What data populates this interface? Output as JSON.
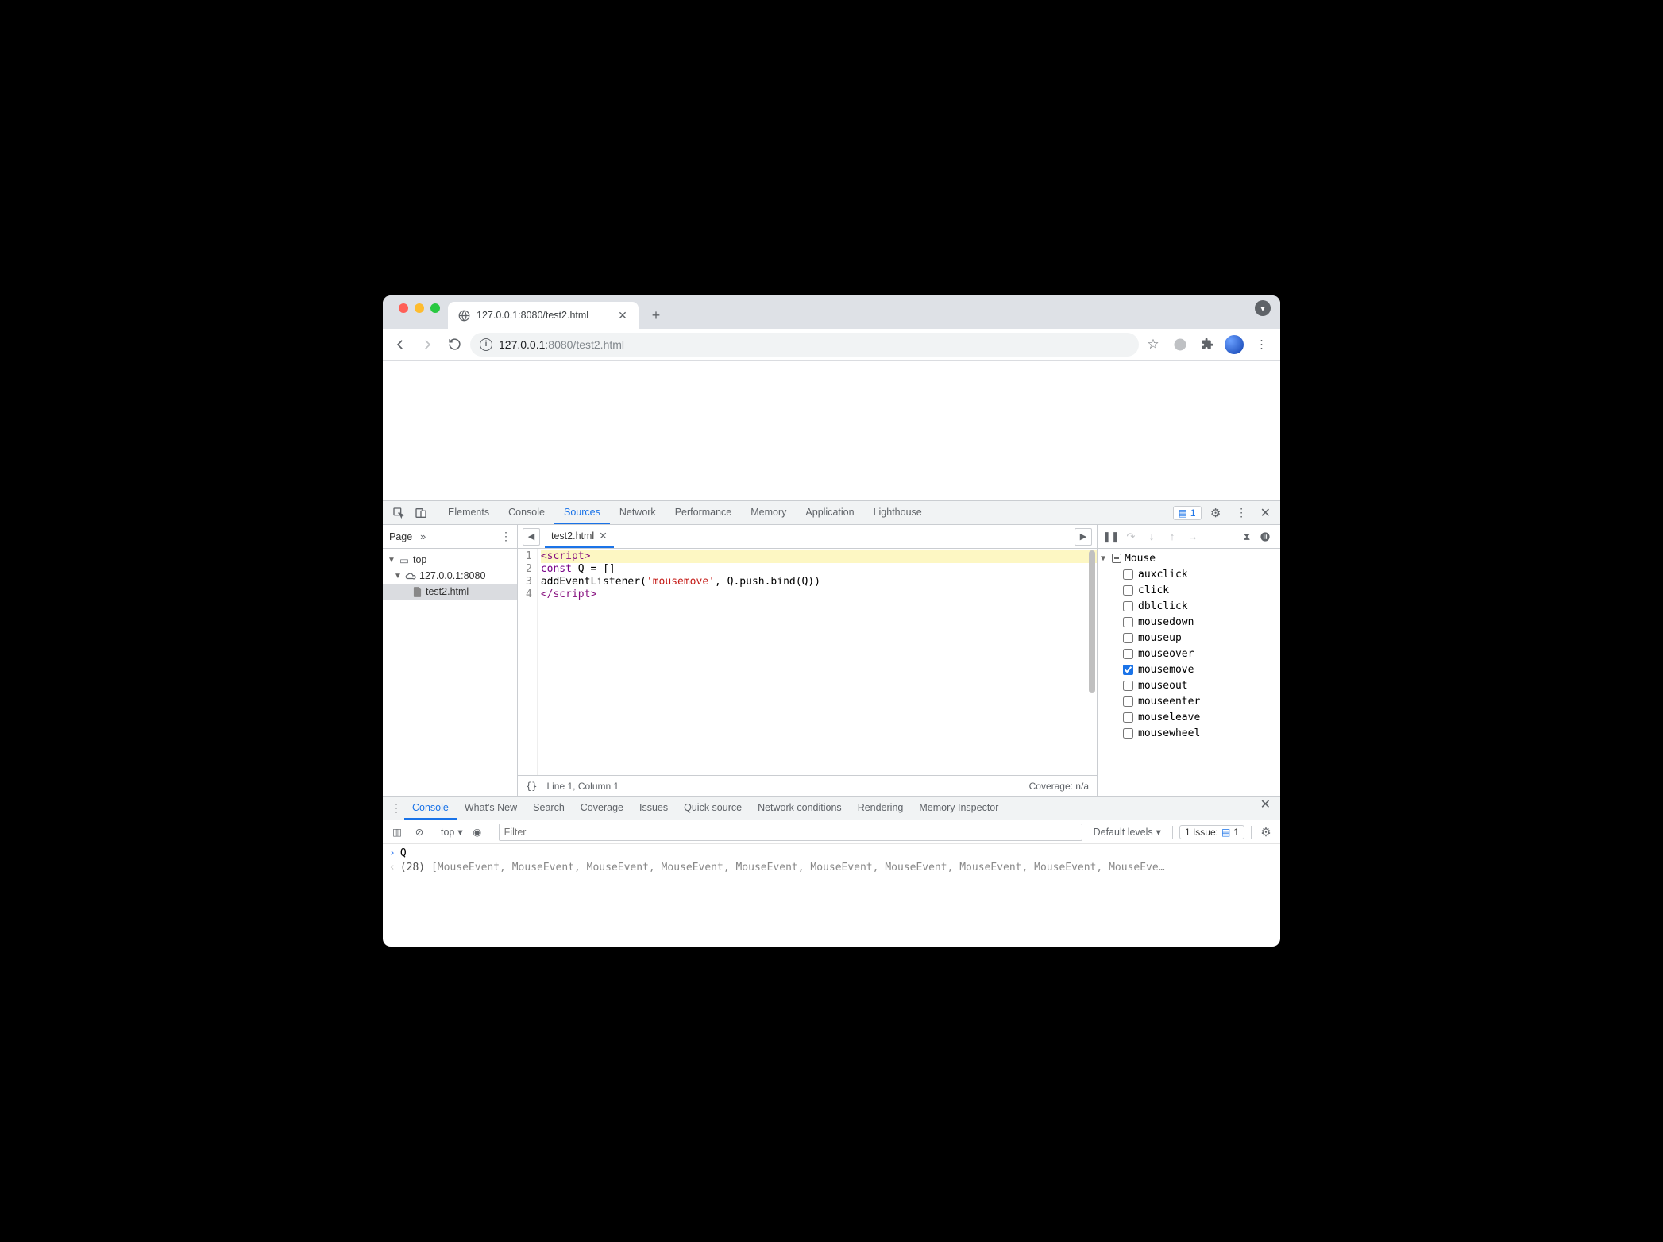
{
  "browser": {
    "tab_title": "127.0.0.1:8080/test2.html",
    "url_prefix": "127.0.0.1",
    "url_port": ":8080",
    "url_path": "/test2.html"
  },
  "devtools": {
    "tabs": [
      "Elements",
      "Console",
      "Sources",
      "Network",
      "Performance",
      "Memory",
      "Application",
      "Lighthouse"
    ],
    "active_tab": "Sources",
    "issue_count": "1"
  },
  "navigator": {
    "header": "Page",
    "tree": {
      "top": "top",
      "origin": "127.0.0.1:8080",
      "file": "test2.html"
    }
  },
  "editor": {
    "filename": "test2.html",
    "lines": {
      "l1a": "<script>",
      "l2a": "const",
      "l2b": " Q = []",
      "l3a": "addEventListener(",
      "l3b": "'mousemove'",
      "l3c": ", Q.push.bind(Q))",
      "l4a": "</",
      "l4b": "script>"
    },
    "gutter": [
      "1",
      "2",
      "3",
      "4"
    ],
    "status_braces": "{}",
    "status_pos": "Line 1, Column 1",
    "status_coverage": "Coverage: n/a"
  },
  "breakpoints": {
    "category": "Mouse",
    "items": [
      {
        "label": "auxclick",
        "checked": false
      },
      {
        "label": "click",
        "checked": false
      },
      {
        "label": "dblclick",
        "checked": false
      },
      {
        "label": "mousedown",
        "checked": false
      },
      {
        "label": "mouseup",
        "checked": false
      },
      {
        "label": "mouseover",
        "checked": false
      },
      {
        "label": "mousemove",
        "checked": true
      },
      {
        "label": "mouseout",
        "checked": false
      },
      {
        "label": "mouseenter",
        "checked": false
      },
      {
        "label": "mouseleave",
        "checked": false
      },
      {
        "label": "mousewheel",
        "checked": false
      }
    ]
  },
  "drawer": {
    "tabs": [
      "Console",
      "What's New",
      "Search",
      "Coverage",
      "Issues",
      "Quick source",
      "Network conditions",
      "Rendering",
      "Memory Inspector"
    ],
    "active_tab": "Console",
    "context": "top",
    "filter_placeholder": "Filter",
    "levels": "Default levels",
    "issue_label": "1 Issue:",
    "issue_num": "1"
  },
  "console": {
    "input": "Q",
    "result_count": "(28)",
    "result_body": "[MouseEvent, MouseEvent, MouseEvent, MouseEvent, MouseEvent, MouseEvent, MouseEvent, MouseEvent, MouseEvent, MouseEve…"
  }
}
